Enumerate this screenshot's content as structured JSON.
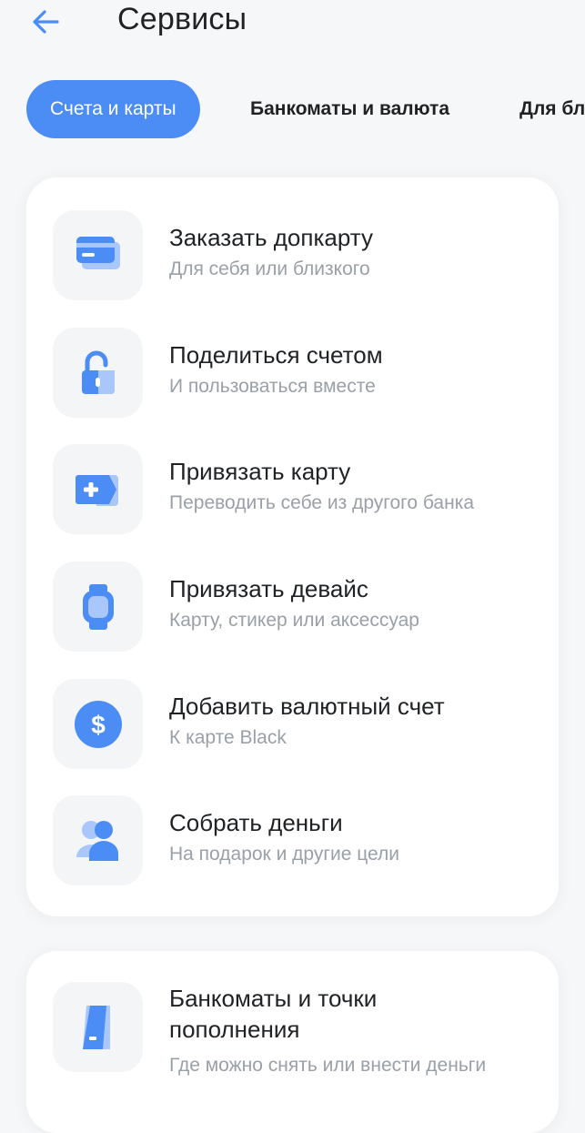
{
  "header": {
    "title": "Сервисы"
  },
  "tabs": [
    {
      "label": "Счета и карты",
      "active": true
    },
    {
      "label": "Банкоматы и валюта",
      "active": false
    },
    {
      "label": "Для бл",
      "active": false
    }
  ],
  "services": [
    {
      "icon": "card-icon",
      "title": "Заказать допкарту",
      "subtitle": "Для себя или близкого"
    },
    {
      "icon": "unlock-icon",
      "title": "Поделиться счетом",
      "subtitle": "И пользоваться вместе"
    },
    {
      "icon": "add-card-icon",
      "title": "Привязать карту",
      "subtitle": "Переводить себе из другого банка"
    },
    {
      "icon": "watch-icon",
      "title": "Привязать девайс",
      "subtitle": "Карту, стикер или аксессуар"
    },
    {
      "icon": "currency-icon",
      "title": "Добавить валютный счет",
      "subtitle": "К карте Black"
    },
    {
      "icon": "people-icon",
      "title": "Собрать деньги",
      "subtitle": "На подарок и другие цели"
    }
  ],
  "atm": {
    "icon": "atm-icon",
    "title_line1": "Банкоматы и точки",
    "title_line2": "пополнения",
    "subtitle": "Где можно снять или внести деньги"
  },
  "colors": {
    "accent": "#4b8df4",
    "icon_light": "#a9c7fa",
    "background": "#f6f7f8"
  }
}
